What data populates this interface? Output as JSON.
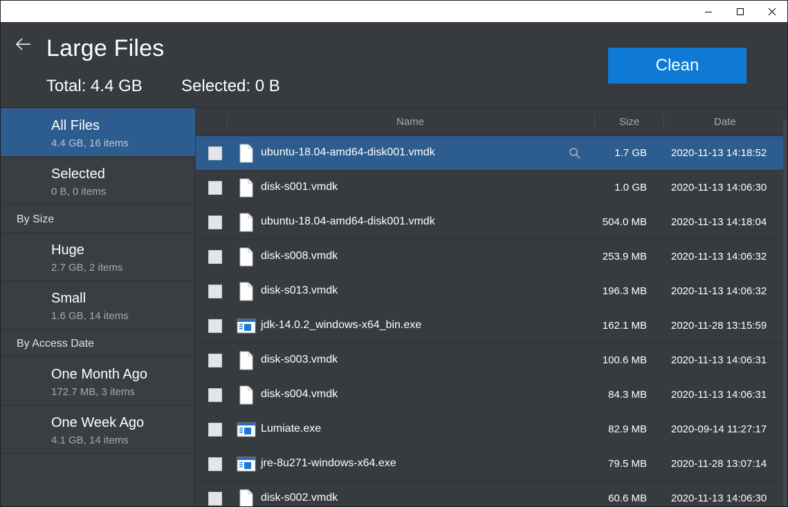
{
  "window": {
    "minimize_icon": "minimize-icon",
    "maximize_icon": "maximize-icon",
    "close_icon": "close-icon"
  },
  "header": {
    "title": "Large Files",
    "total_label": "Total:",
    "total_value": "4.4 GB",
    "selected_label": "Selected:",
    "selected_value": "0 B",
    "clean_label": "Clean",
    "accent_color": "#0e7ad5"
  },
  "sidebar": {
    "all_files": {
      "label": "All Files",
      "sub": "4.4 GB, 16 items"
    },
    "selected": {
      "label": "Selected",
      "sub": "0 B, 0 items"
    },
    "by_size_label": "By Size",
    "huge": {
      "label": "Huge",
      "sub": "2.7 GB, 2 items"
    },
    "small": {
      "label": "Small",
      "sub": "1.6 GB, 14 items"
    },
    "by_access_label": "By Access Date",
    "month": {
      "label": "One Month Ago",
      "sub": "172.7 MB, 3 items"
    },
    "week": {
      "label": "One Week Ago",
      "sub": "4.1 GB, 14 items"
    }
  },
  "list": {
    "col_name": "Name",
    "col_size": "Size",
    "col_date": "Date",
    "rows": [
      {
        "name": "ubuntu-18.04-amd64-disk001.vmdk",
        "size": "1.7 GB",
        "date": "2020-11-13 14:18:52",
        "icon": "document-icon"
      },
      {
        "name": "disk-s001.vmdk",
        "size": "1.0 GB",
        "date": "2020-11-13 14:06:30",
        "icon": "document-icon"
      },
      {
        "name": "ubuntu-18.04-amd64-disk001.vmdk",
        "size": "504.0 MB",
        "date": "2020-11-13 14:18:04",
        "icon": "document-icon"
      },
      {
        "name": "disk-s008.vmdk",
        "size": "253.9 MB",
        "date": "2020-11-13 14:06:32",
        "icon": "document-icon"
      },
      {
        "name": "disk-s013.vmdk",
        "size": "196.3 MB",
        "date": "2020-11-13 14:06:32",
        "icon": "document-icon"
      },
      {
        "name": "jdk-14.0.2_windows-x64_bin.exe",
        "size": "162.1 MB",
        "date": "2020-11-28 13:15:59",
        "icon": "executable-icon"
      },
      {
        "name": "disk-s003.vmdk",
        "size": "100.6 MB",
        "date": "2020-11-13 14:06:31",
        "icon": "document-icon"
      },
      {
        "name": "disk-s004.vmdk",
        "size": "84.3 MB",
        "date": "2020-11-13 14:06:31",
        "icon": "document-icon"
      },
      {
        "name": "Lumiate.exe",
        "size": "82.9 MB",
        "date": "2020-09-14 11:27:17",
        "icon": "executable-icon"
      },
      {
        "name": "jre-8u271-windows-x64.exe",
        "size": "79.5 MB",
        "date": "2020-11-28 13:07:14",
        "icon": "executable-icon"
      },
      {
        "name": "disk-s002.vmdk",
        "size": "60.6 MB",
        "date": "2020-11-13 14:06:30",
        "icon": "document-icon"
      }
    ]
  }
}
